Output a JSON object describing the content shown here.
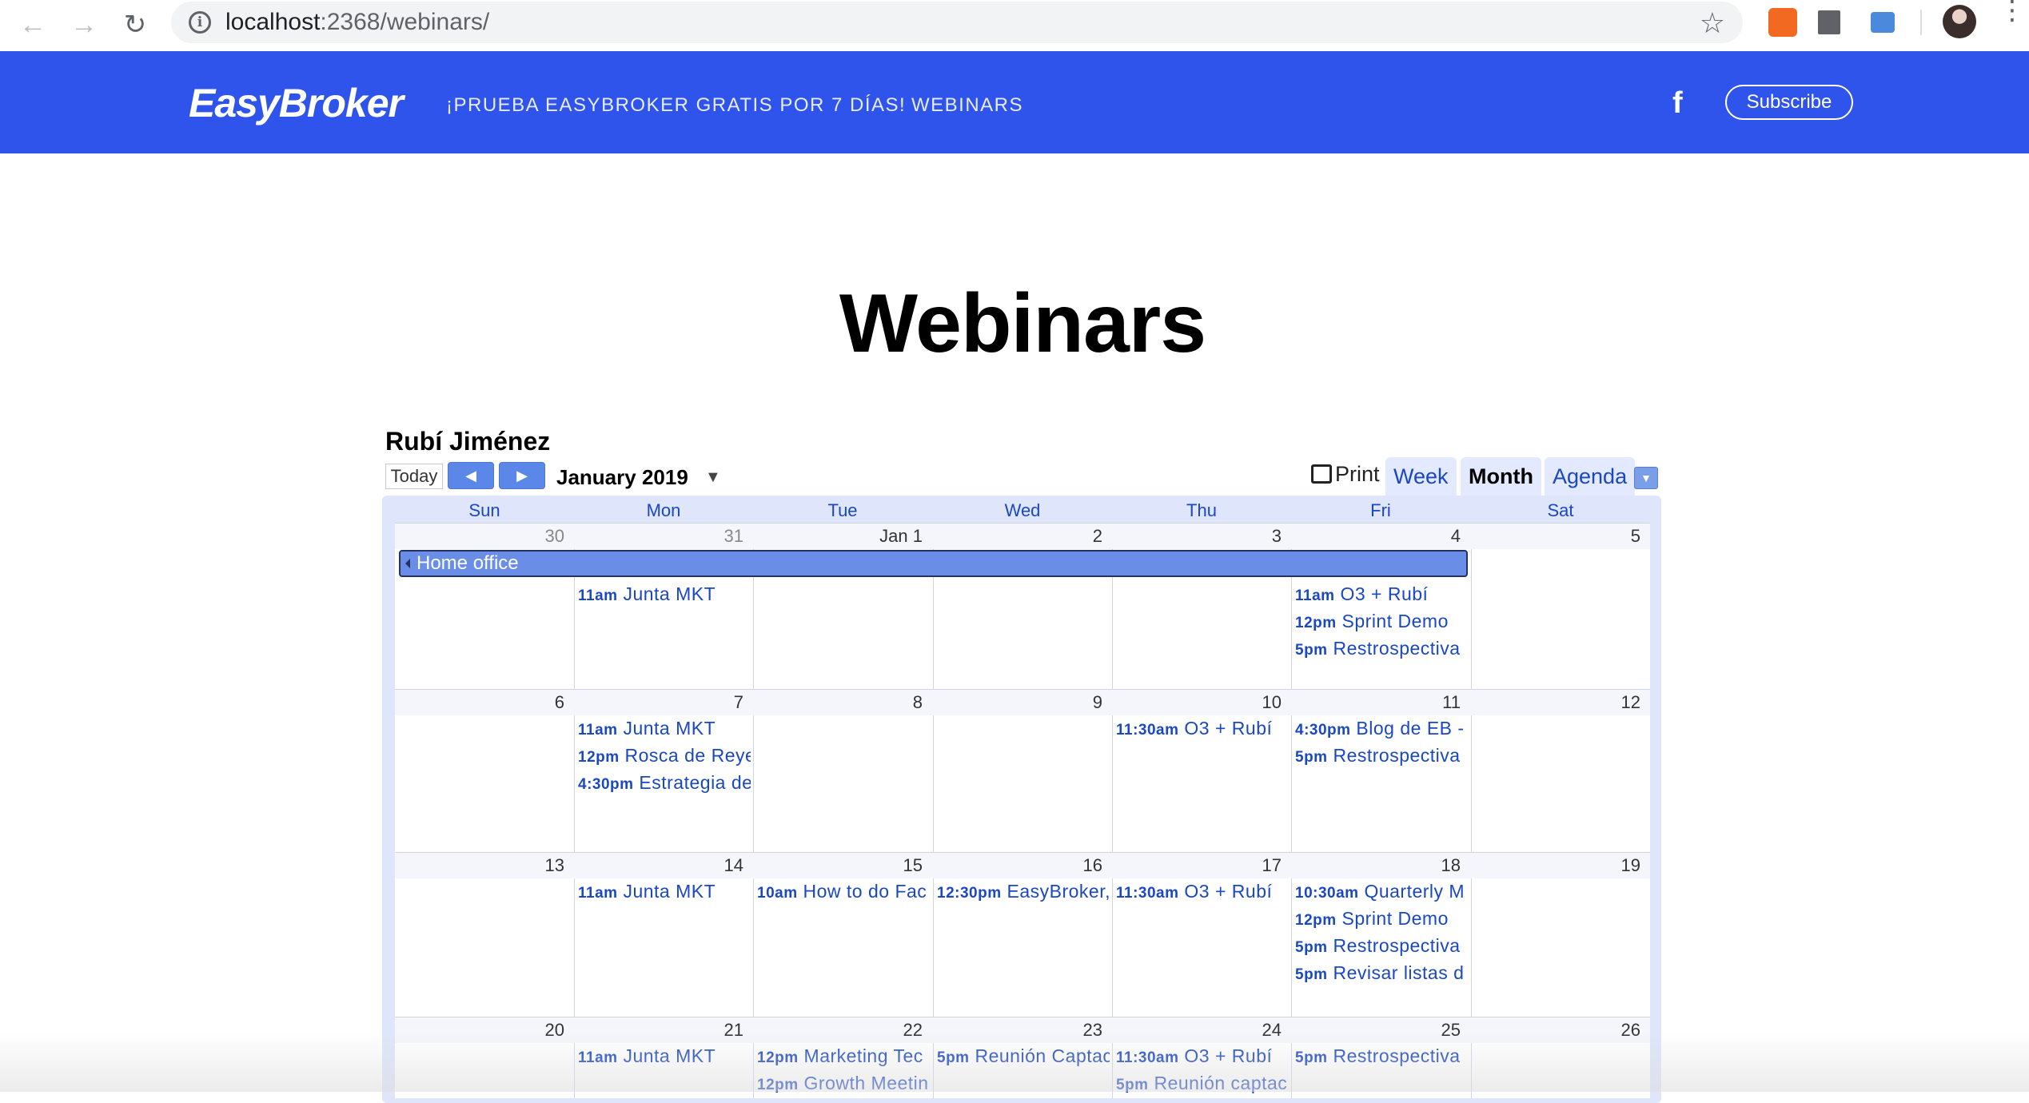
{
  "browser": {
    "url_host": "localhost",
    "url_path": ":2368/webinars/"
  },
  "site": {
    "logo": "EasyBroker",
    "nav": [
      "¡PRUEBA EASYBROKER GRATIS POR 7 DÍAS!",
      "WEBINARS"
    ],
    "facebook_icon": "f",
    "subscribe": "Subscribe"
  },
  "page": {
    "title": "Webinars"
  },
  "calendar": {
    "owner": "Rubí Jiménez",
    "today": "Today",
    "month": "January 2019",
    "print": "Print",
    "views": [
      "Week",
      "Month",
      "Agenda"
    ],
    "active_view": "Month",
    "weekdays": [
      "Sun",
      "Mon",
      "Tue",
      "Wed",
      "Thu",
      "Fri",
      "Sat"
    ],
    "allday_event": "Home office",
    "weeks": [
      {
        "days": [
          "30",
          "31",
          "Jan 1",
          "2",
          "3",
          "4",
          "5"
        ],
        "events": [
          [],
          [
            {
              "time": "11am",
              "title": "Junta MKT"
            }
          ],
          [],
          [],
          [],
          [
            {
              "time": "11am",
              "title": "O3 + Rubí"
            },
            {
              "time": "12pm",
              "title": "Sprint Demo"
            },
            {
              "time": "5pm",
              "title": "Restrospectiva"
            }
          ],
          []
        ]
      },
      {
        "days": [
          "6",
          "7",
          "8",
          "9",
          "10",
          "11",
          "12"
        ],
        "events": [
          [],
          [
            {
              "time": "11am",
              "title": "Junta MKT"
            },
            {
              "time": "12pm",
              "title": "Rosca de Reye"
            },
            {
              "time": "4:30pm",
              "title": "Estrategia de"
            }
          ],
          [],
          [],
          [
            {
              "time": "11:30am",
              "title": "O3 + Rubí"
            }
          ],
          [
            {
              "time": "4:30pm",
              "title": "Blog de EB -"
            },
            {
              "time": "5pm",
              "title": "Restrospectiva"
            }
          ],
          []
        ]
      },
      {
        "days": [
          "13",
          "14",
          "15",
          "16",
          "17",
          "18",
          "19"
        ],
        "events": [
          [],
          [
            {
              "time": "11am",
              "title": "Junta MKT"
            }
          ],
          [
            {
              "time": "10am",
              "title": "How to do Fac"
            }
          ],
          [
            {
              "time": "12:30pm",
              "title": "EasyBroker,"
            }
          ],
          [
            {
              "time": "11:30am",
              "title": "O3 + Rubí"
            }
          ],
          [
            {
              "time": "10:30am",
              "title": "Quarterly M"
            },
            {
              "time": "12pm",
              "title": "Sprint Demo"
            },
            {
              "time": "5pm",
              "title": "Restrospectiva"
            },
            {
              "time": "5pm",
              "title": "Revisar listas d"
            }
          ],
          []
        ]
      },
      {
        "days": [
          "20",
          "21",
          "22",
          "23",
          "24",
          "25",
          "26"
        ],
        "events": [
          [],
          [
            {
              "time": "11am",
              "title": "Junta MKT"
            }
          ],
          [
            {
              "time": "12pm",
              "title": "Marketing Tec"
            },
            {
              "time": "12pm",
              "title": "Growth Meetin"
            }
          ],
          [
            {
              "time": "5pm",
              "title": "Reunión Captac"
            }
          ],
          [
            {
              "time": "11:30am",
              "title": "O3 + Rubí"
            },
            {
              "time": "5pm",
              "title": "Reunión captac"
            }
          ],
          [
            {
              "time": "5pm",
              "title": "Restrospectiva"
            }
          ],
          []
        ]
      }
    ]
  }
}
